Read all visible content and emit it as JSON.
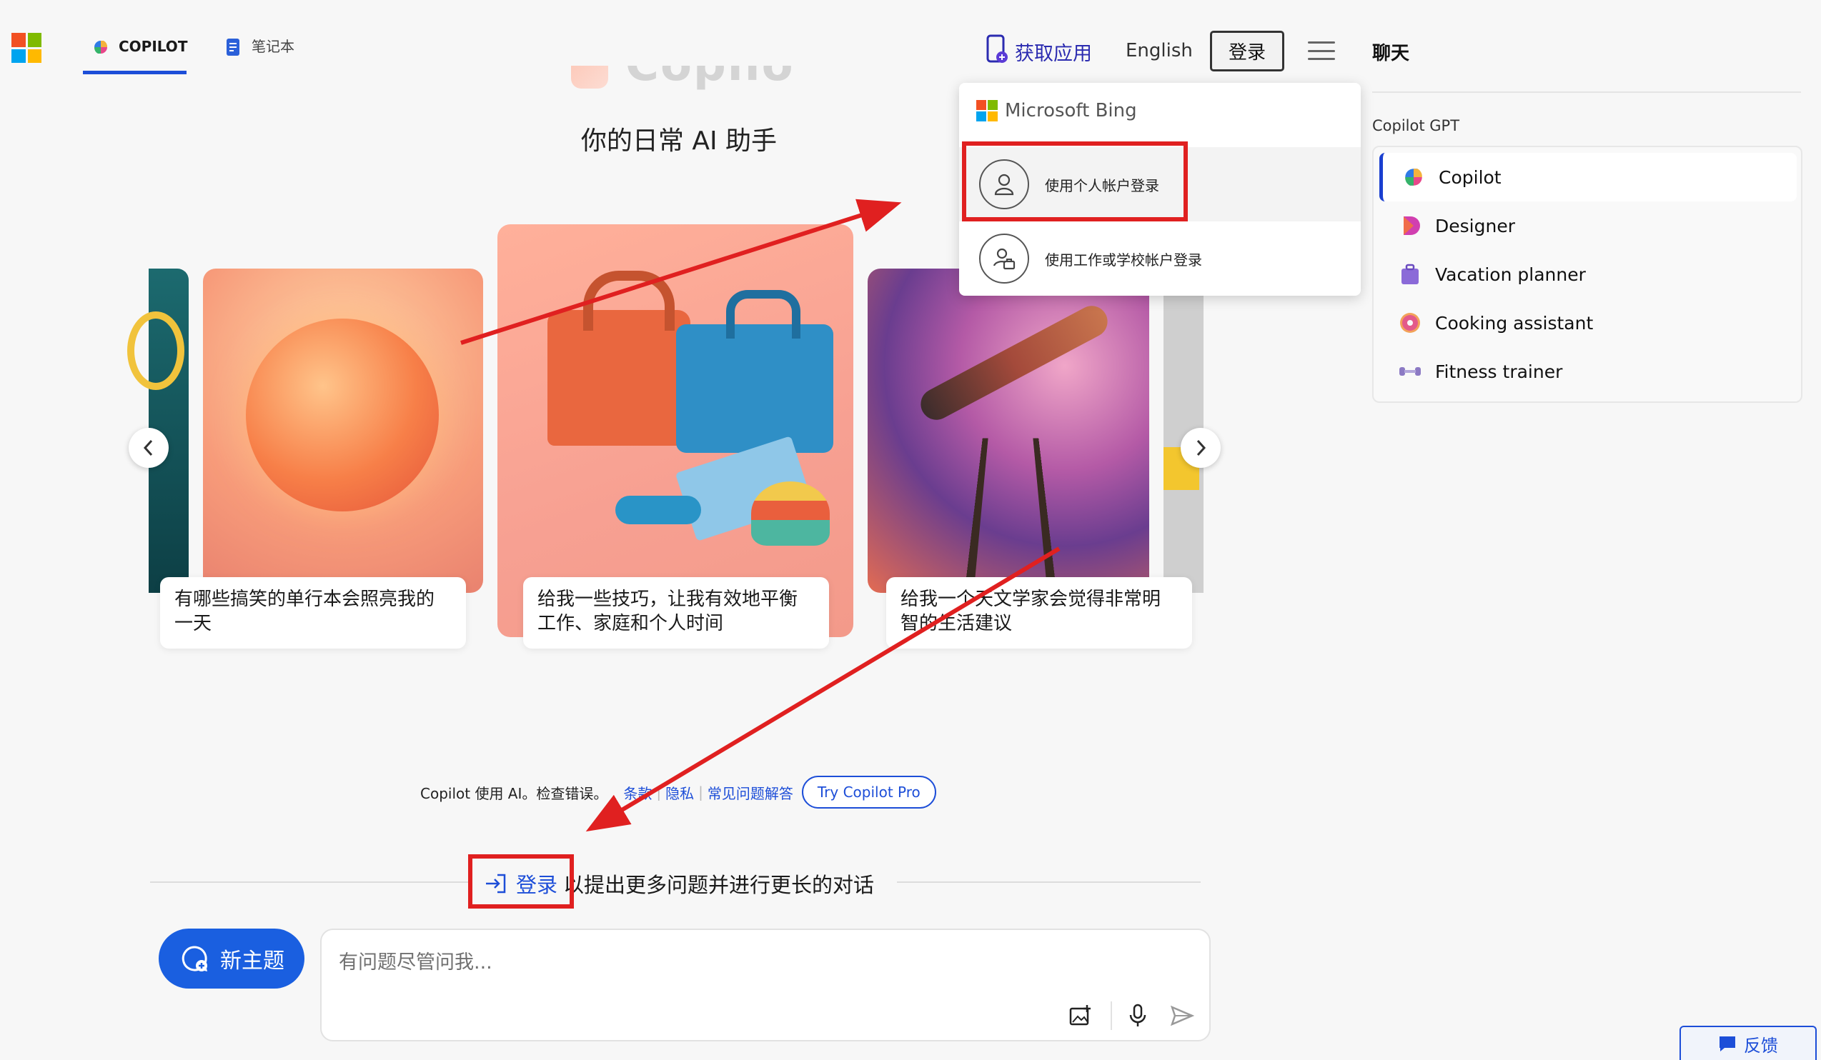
{
  "header": {
    "tabs": [
      {
        "label": "COPILOT",
        "icon": "copilot-icon",
        "active": true
      },
      {
        "label": "笔记本",
        "icon": "notebook-icon",
        "active": false
      }
    ],
    "get_app": "获取应用",
    "language": "English",
    "login": "登录"
  },
  "hero": {
    "logo_text": "Copilot",
    "tagline": "你的日常 AI 助手"
  },
  "carousel": {
    "captions": [
      "有哪些搞笑的单行本会照亮我的一天",
      "给我一些技巧，让我有效地平衡工作、家庭和个人时间",
      "给我一个天文学家会觉得非常明智的生活建议"
    ]
  },
  "footer": {
    "disclaimer": "Copilot 使用 AI。检查错误。",
    "terms": "条款",
    "privacy": "隐私",
    "faq": "常见问题解答",
    "try_pro": "Try Copilot Pro"
  },
  "signin_prompt": {
    "link": "登录",
    "rest": "以提出更多问题并进行更长的对话"
  },
  "compose": {
    "new_topic": "新主题",
    "placeholder": "有问题尽管问我..."
  },
  "dropdown": {
    "brand": "Microsoft Bing",
    "personal": "使用个人帐户登录",
    "work": "使用工作或学校帐户登录"
  },
  "sidebar": {
    "title": "聊天",
    "section": "Copilot GPT",
    "items": [
      {
        "label": "Copilot",
        "icon": "copilot-icon"
      },
      {
        "label": "Designer",
        "icon": "designer-icon"
      },
      {
        "label": "Vacation planner",
        "icon": "suitcase-icon"
      },
      {
        "label": "Cooking assistant",
        "icon": "donut-icon"
      },
      {
        "label": "Fitness trainer",
        "icon": "dumbbell-icon"
      }
    ]
  },
  "feedback": "反馈",
  "colors": {
    "accent": "#1d4ed8",
    "new_topic": "#1a5fe0",
    "annotation": "#e02020"
  }
}
